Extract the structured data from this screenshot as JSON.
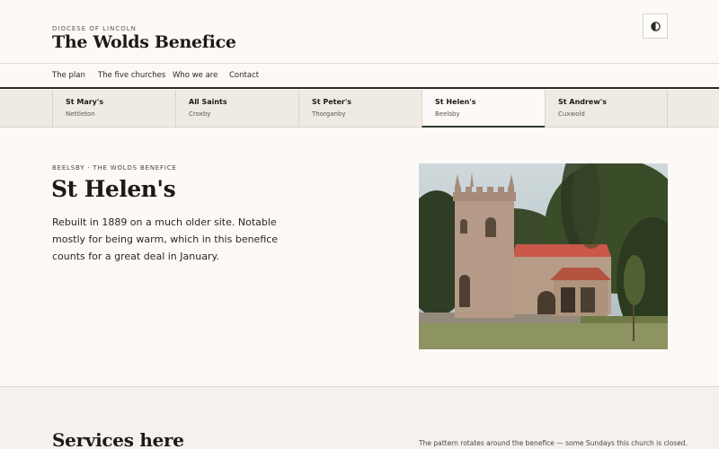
{
  "header": {
    "diocese": "DIOCESE OF LINCOLN",
    "title": "The Wolds Benefice",
    "theme_icon": "contrast-icon"
  },
  "nav": {
    "items": [
      {
        "label": "The plan"
      },
      {
        "label": "The five churches"
      },
      {
        "label": "Who we are"
      },
      {
        "label": "Contact"
      }
    ]
  },
  "churches": [
    {
      "name": "St Mary's",
      "place": "Nettleton"
    },
    {
      "name": "All Saints",
      "place": "Croxby"
    },
    {
      "name": "St Peter's",
      "place": "Thorganby"
    },
    {
      "name": "St Helen's",
      "place": "Beelsby",
      "active": true
    },
    {
      "name": "St Andrew's",
      "place": "Cuxwold"
    }
  ],
  "main": {
    "eyebrow": "BEELSBY · THE WOLDS BENEFICE",
    "title": "St Helen's",
    "description": "Rebuilt in 1889 on a much older site. Notable mostly for being warm, which in this benefice counts for a great deal in January."
  },
  "services": {
    "title": "Services here",
    "note": "The pattern rotates around the benefice — some Sundays this church is closed."
  },
  "colors": {
    "background": "#fcf9f7",
    "tab_bar": "#f0ebe2",
    "active_tab_underline": "#2d3a2a",
    "text": "#1c1a17"
  }
}
